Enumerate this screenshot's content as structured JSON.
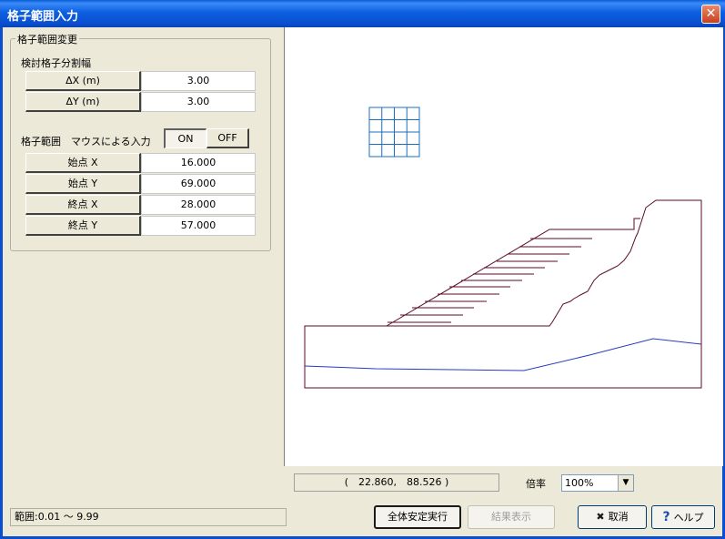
{
  "window": {
    "title": "格子範囲入力"
  },
  "group_legend": "格子範囲変更",
  "division_width": {
    "label": "検討格子分割幅",
    "rows": [
      {
        "label": "ΔX (m)",
        "value": "3.00"
      },
      {
        "label": "ΔY (m)",
        "value": "3.00"
      }
    ]
  },
  "grid_range": {
    "label": "格子範囲　マウスによる入力",
    "toggle_on": "ON",
    "toggle_off": "OFF",
    "rows": [
      {
        "label": "始点 X",
        "value": "16.000"
      },
      {
        "label": "始点 Y",
        "value": "69.000"
      },
      {
        "label": "終点 X",
        "value": "28.000"
      },
      {
        "label": "終点 Y",
        "value": "57.000"
      }
    ]
  },
  "status": {
    "coordinates": "(　22.860,　88.526 )",
    "zoom_label": "倍率",
    "zoom_value": "100%",
    "range": "範囲:0.01 ～ 9.99"
  },
  "buttons": {
    "run": "全体安定実行",
    "results": "結果表示",
    "cancel": "取消",
    "help": "ヘルプ"
  },
  "colors": {
    "title_bar": "#0a5fd8",
    "grid": "#1a6fc0",
    "slope_outline": "#5a0a2a",
    "water_line": "#2a3ac0"
  }
}
